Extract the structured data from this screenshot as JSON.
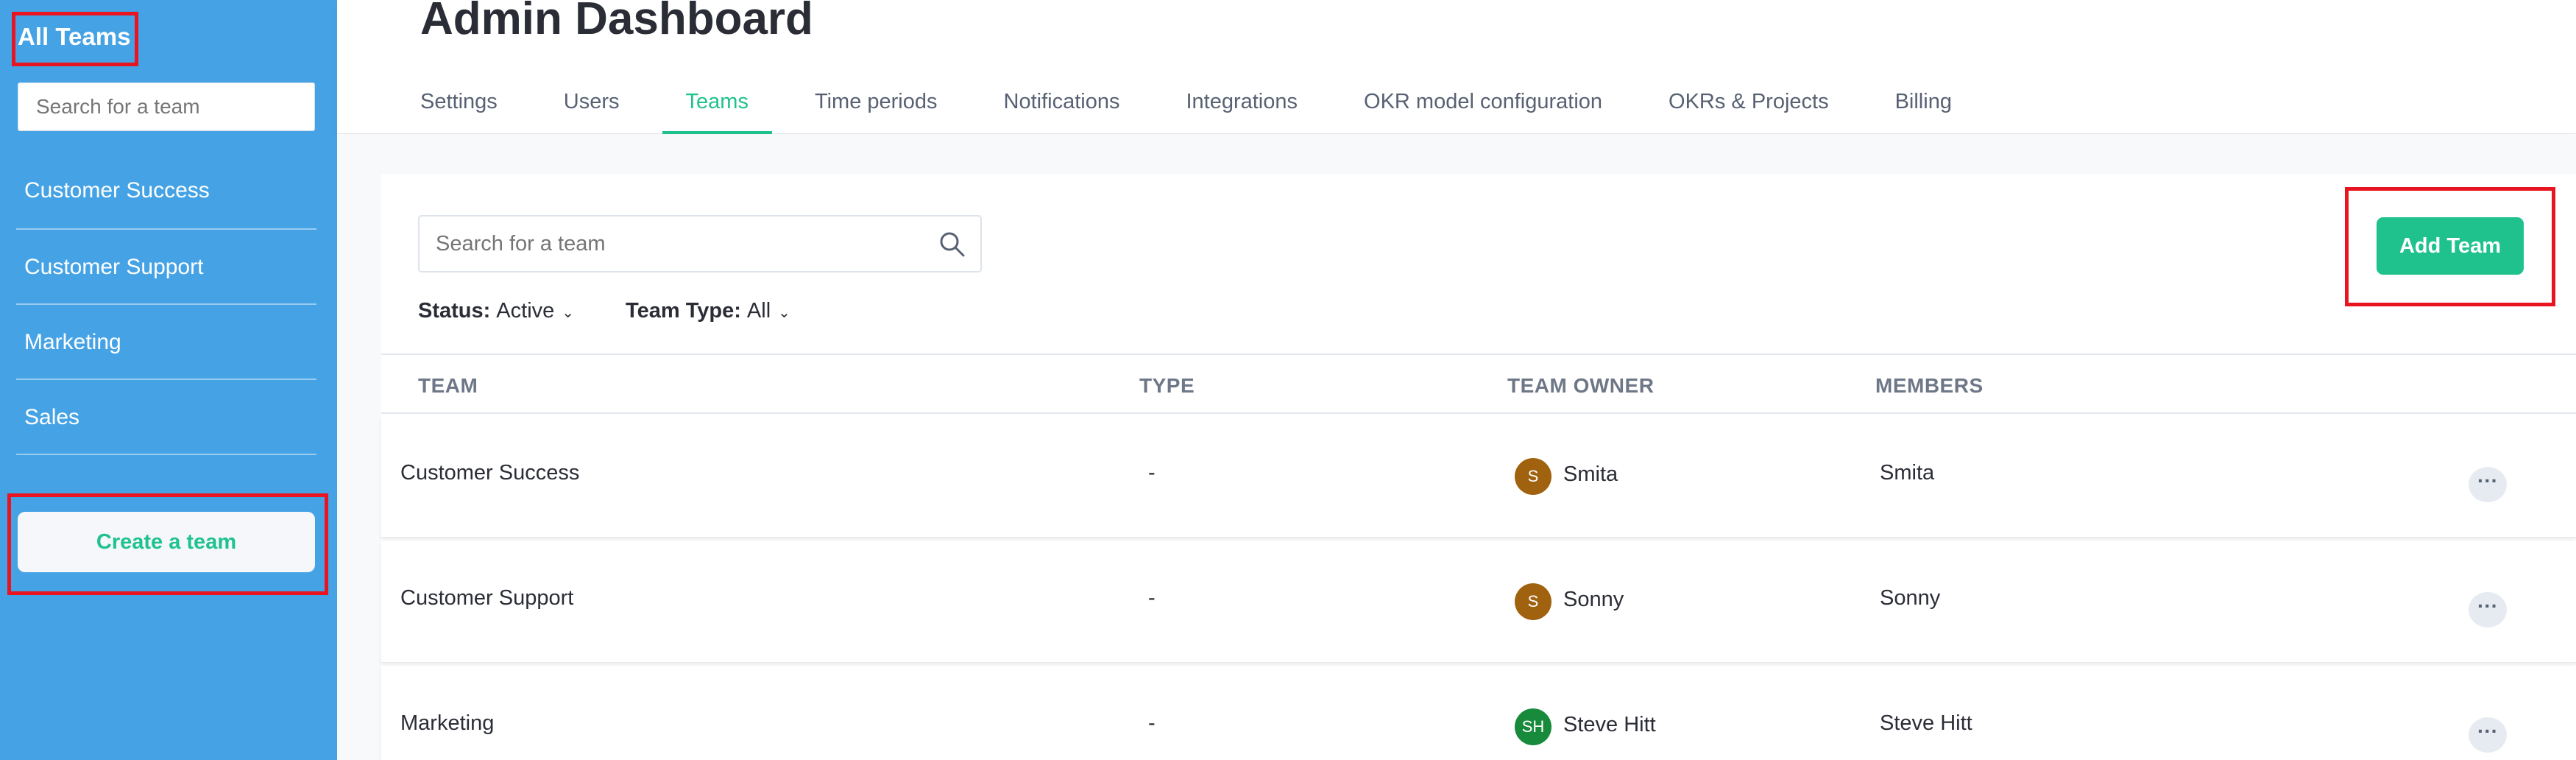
{
  "sidebar": {
    "title": "All Teams",
    "search_placeholder": "Search for a team",
    "items": [
      {
        "label": "Customer Success"
      },
      {
        "label": "Customer Support"
      },
      {
        "label": "Marketing"
      },
      {
        "label": "Sales"
      }
    ],
    "create_label": "Create a team"
  },
  "header": {
    "title": "Admin Dashboard",
    "tabs": [
      {
        "label": "Settings"
      },
      {
        "label": "Users"
      },
      {
        "label": "Teams",
        "active": true
      },
      {
        "label": "Time periods"
      },
      {
        "label": "Notifications"
      },
      {
        "label": "Integrations"
      },
      {
        "label": "OKR model configuration"
      },
      {
        "label": "OKRs & Projects"
      },
      {
        "label": "Billing"
      }
    ]
  },
  "main": {
    "search_placeholder": "Search for a team",
    "filters": {
      "status_label": "Status:",
      "status_value": "Active",
      "type_label": "Team Type:",
      "type_value": "All"
    },
    "add_team_label": "Add Team",
    "columns": [
      "TEAM",
      "TYPE",
      "TEAM OWNER",
      "MEMBERS"
    ],
    "rows": [
      {
        "team": "Customer Success",
        "type": "-",
        "owner_initials": "S",
        "owner": "Smita",
        "owner_color": "#a0620f",
        "members": "Smita",
        "more": "···"
      },
      {
        "team": "Customer Support",
        "type": "-",
        "owner_initials": "S",
        "owner": "Sonny",
        "owner_color": "#a0620f",
        "members": "Sonny",
        "more": "···"
      },
      {
        "team": "Marketing",
        "type": "-",
        "owner_initials": "SH",
        "owner": "Steve Hitt",
        "owner_color": "#178a3c",
        "members": "Steve Hitt",
        "more": "···"
      }
    ]
  },
  "colors": {
    "sidebar_bg": "#45a3e5",
    "accent_green": "#1fc28d",
    "highlight_red": "#e8141f"
  }
}
